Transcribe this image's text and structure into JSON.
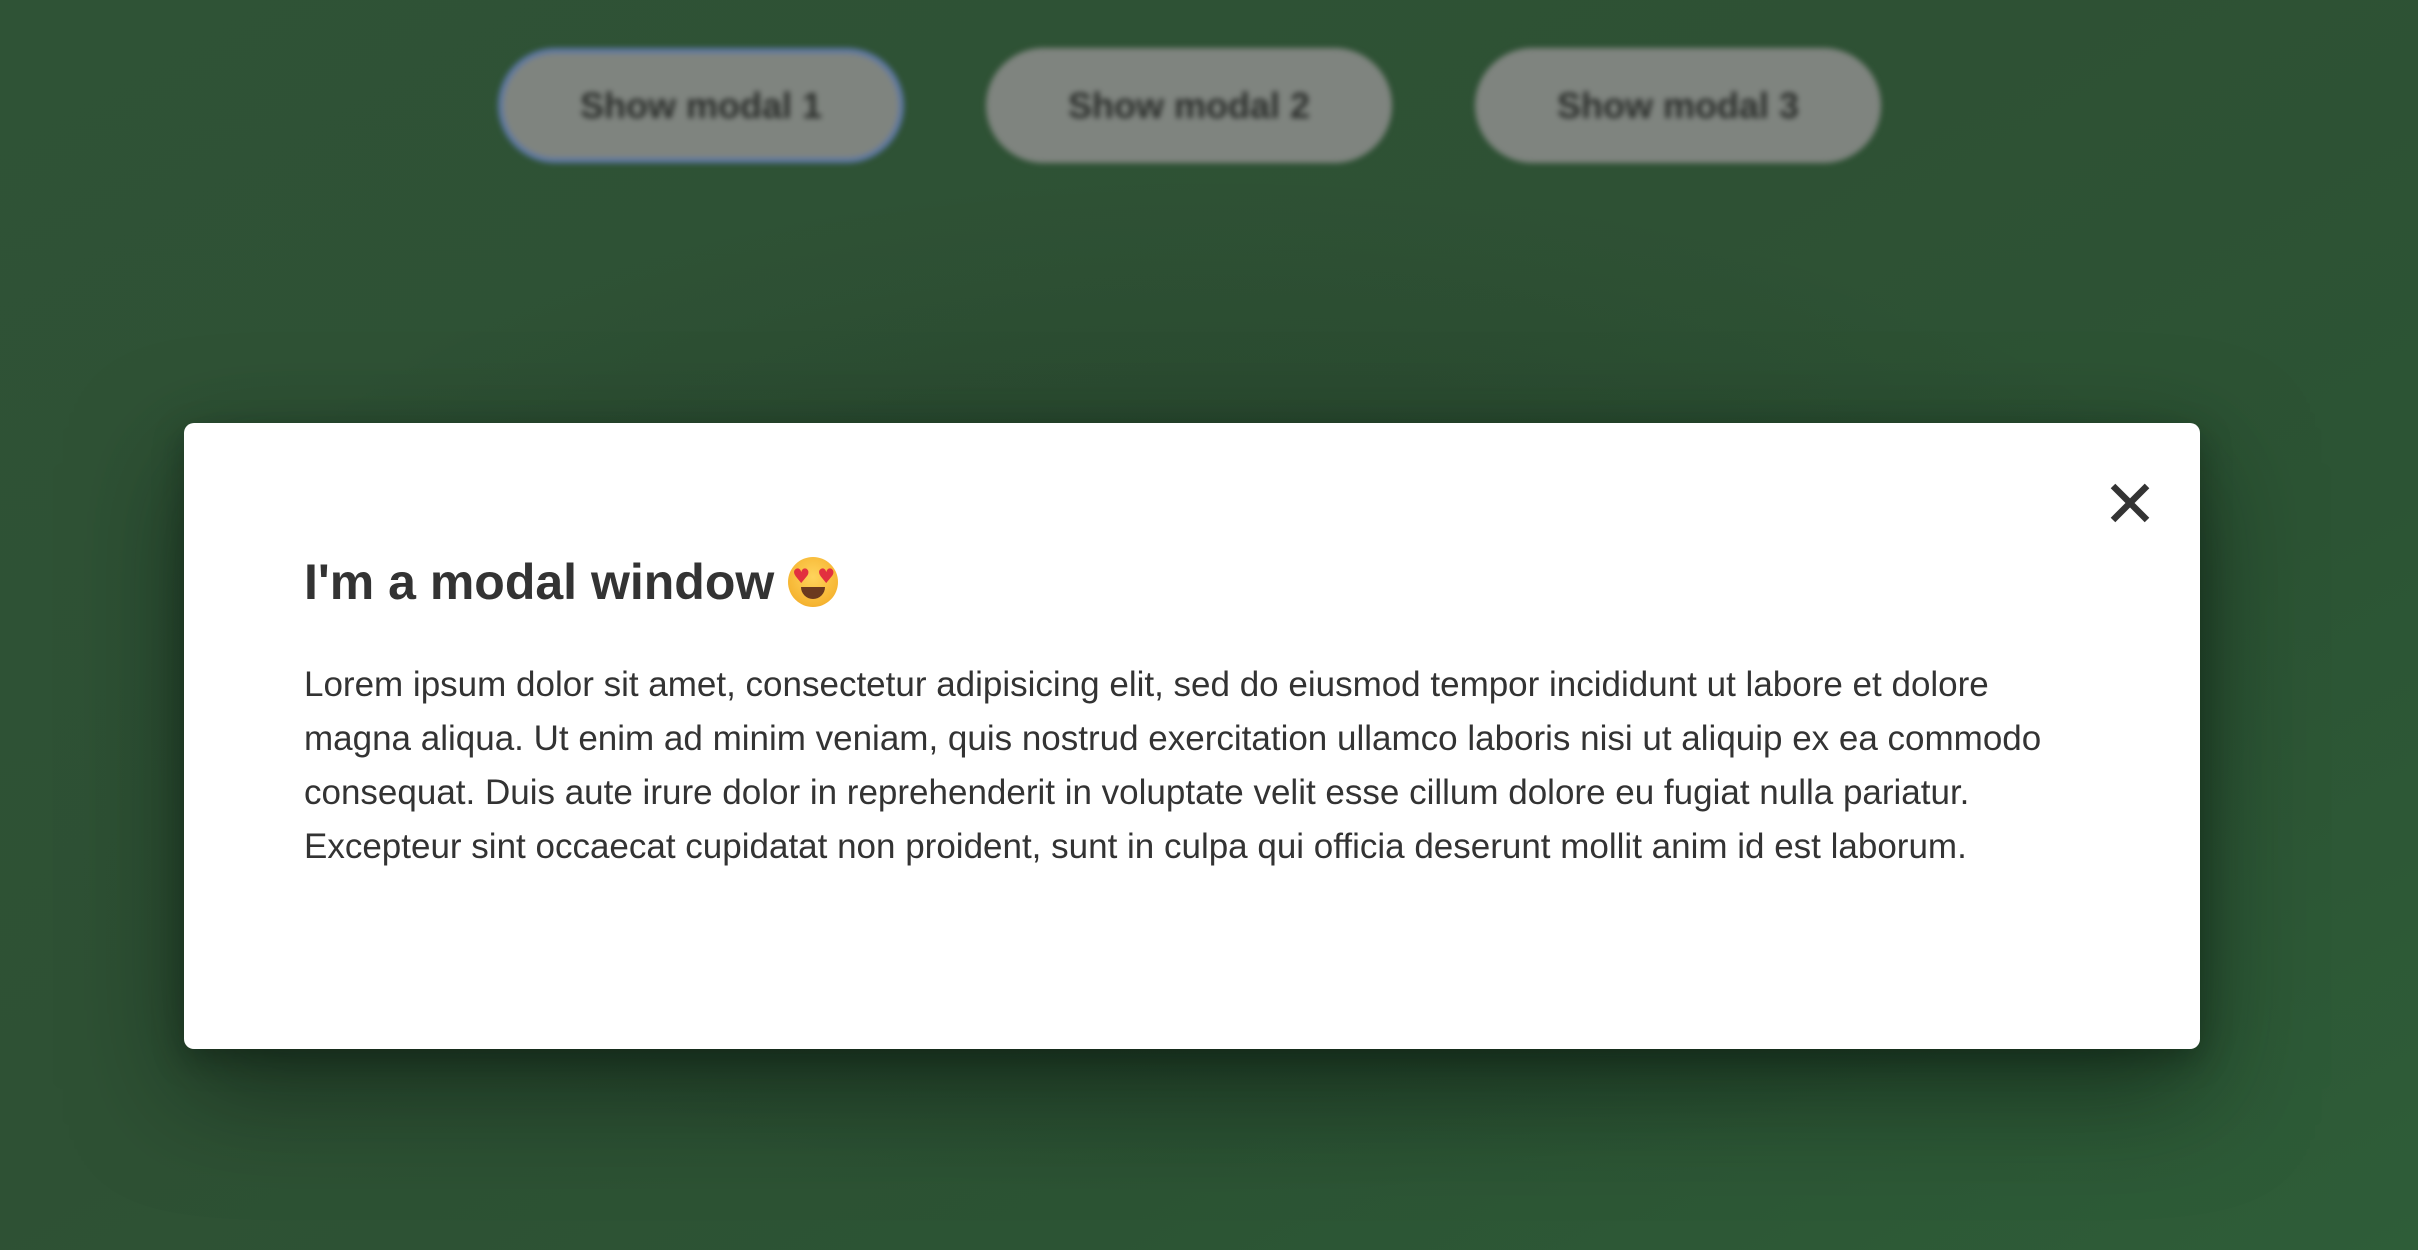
{
  "page": {
    "background_color": "#2f5336"
  },
  "buttons": [
    {
      "label": "Show modal 1",
      "focused": true
    },
    {
      "label": "Show modal 2",
      "focused": false
    },
    {
      "label": "Show modal 3",
      "focused": false
    }
  ],
  "modal": {
    "title": "I'm a modal window",
    "title_emoji": "smiling-face-with-heart-eyes-icon",
    "close_icon": "close-icon",
    "close_glyph": "✕",
    "body": "Lorem ipsum dolor sit amet, consectetur adipisicing elit, sed do eiusmod tempor incididunt ut labore et dolore magna aliqua. Ut enim ad minim veniam, quis nostrud exercitation ullamco laboris nisi ut aliquip ex ea commodo consequat. Duis aute irure dolor in reprehenderit in voluptate velit esse cillum dolore eu fugiat nulla pariatur. Excepteur sint occaecat cupidatat non proident, sunt in culpa qui officia deserunt mollit anim id est laborum."
  }
}
